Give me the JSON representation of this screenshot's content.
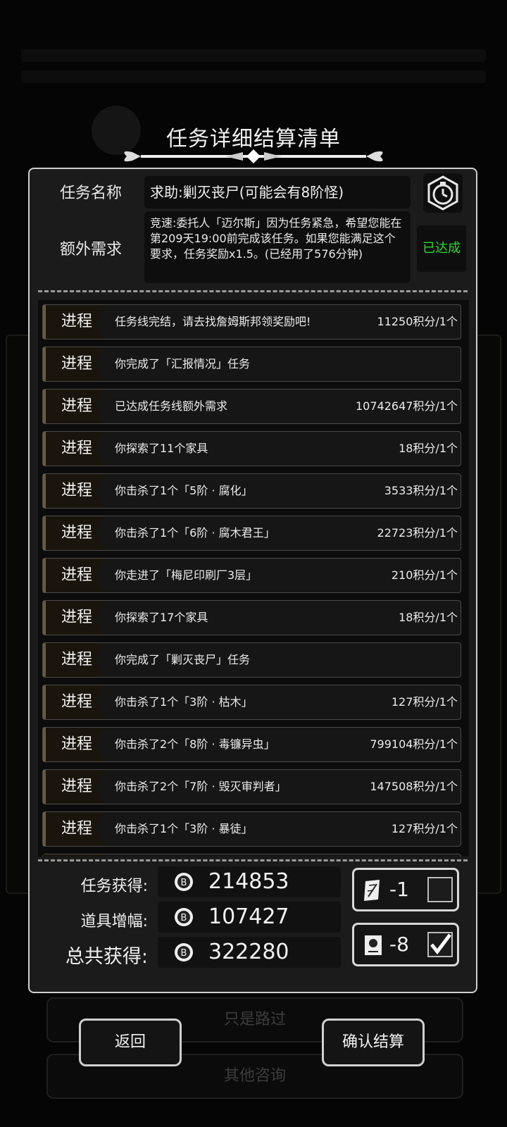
{
  "title": "任务详细结算清单",
  "task": {
    "name_label": "任务名称",
    "name": "求助:剿灭丧尸(可能会有8阶怪)",
    "extra_label": "额外需求",
    "extra_text": "竞速:委托人「迈尔斯」因为任务紧急，希望您能在第209天19:00前完成该任务。如果您能满足这个要求，任务奖励x1.5。(已经用了576分钟)",
    "extra_status": "已达成",
    "icon": "stopwatch-icon"
  },
  "progress_rows": [
    {
      "tag": "进程",
      "text": "任务线完结，请去找詹姆斯邦领奖励吧!",
      "score": "11250积分/1个"
    },
    {
      "tag": "进程",
      "text": "你完成了「汇报情况」任务",
      "score": ""
    },
    {
      "tag": "进程",
      "text": "已达成任务线额外需求",
      "score": "10742647积分/1个"
    },
    {
      "tag": "进程",
      "text": "你探索了11个家具",
      "score": "18积分/1个"
    },
    {
      "tag": "进程",
      "text": "你击杀了1个「5阶 · 腐化」",
      "score": "3533积分/1个"
    },
    {
      "tag": "进程",
      "text": "你击杀了1个「6阶 · 腐木君王」",
      "score": "22723积分/1个"
    },
    {
      "tag": "进程",
      "text": "你走进了「梅尼印刷厂3层」",
      "score": "210积分/1个"
    },
    {
      "tag": "进程",
      "text": "你探索了17个家具",
      "score": "18积分/1个"
    },
    {
      "tag": "进程",
      "text": "你完成了「剿灭丧尸」任务",
      "score": ""
    },
    {
      "tag": "进程",
      "text": "你击杀了1个「3阶 · 枯木」",
      "score": "127积分/1个"
    },
    {
      "tag": "进程",
      "text": "你击杀了2个「8阶 · 毒镰异虫」",
      "score": "799104积分/1个"
    },
    {
      "tag": "进程",
      "text": "你击杀了2个「7阶 · 毁灭审判者」",
      "score": "147508积分/1个"
    },
    {
      "tag": "进程",
      "text": "你击杀了1个「3阶 · 暴徒」",
      "score": "127积分/1个"
    }
  ],
  "totals": {
    "task_label": "任务获得:",
    "task_value": "214853",
    "item_label": "道具增幅:",
    "item_value": "107427",
    "total_label": "总共获得:",
    "total_value": "322280",
    "coin_icon": "coin-icon"
  },
  "items": [
    {
      "icon": "scroll-quill-icon",
      "count": "-1",
      "checked": false
    },
    {
      "icon": "scroll-card-icon",
      "count": "-8",
      "checked": true
    }
  ],
  "buttons": {
    "back": "返回",
    "confirm": "确认结算"
  },
  "background": {
    "btn1": "只是路过",
    "btn2": "其他咨询"
  }
}
